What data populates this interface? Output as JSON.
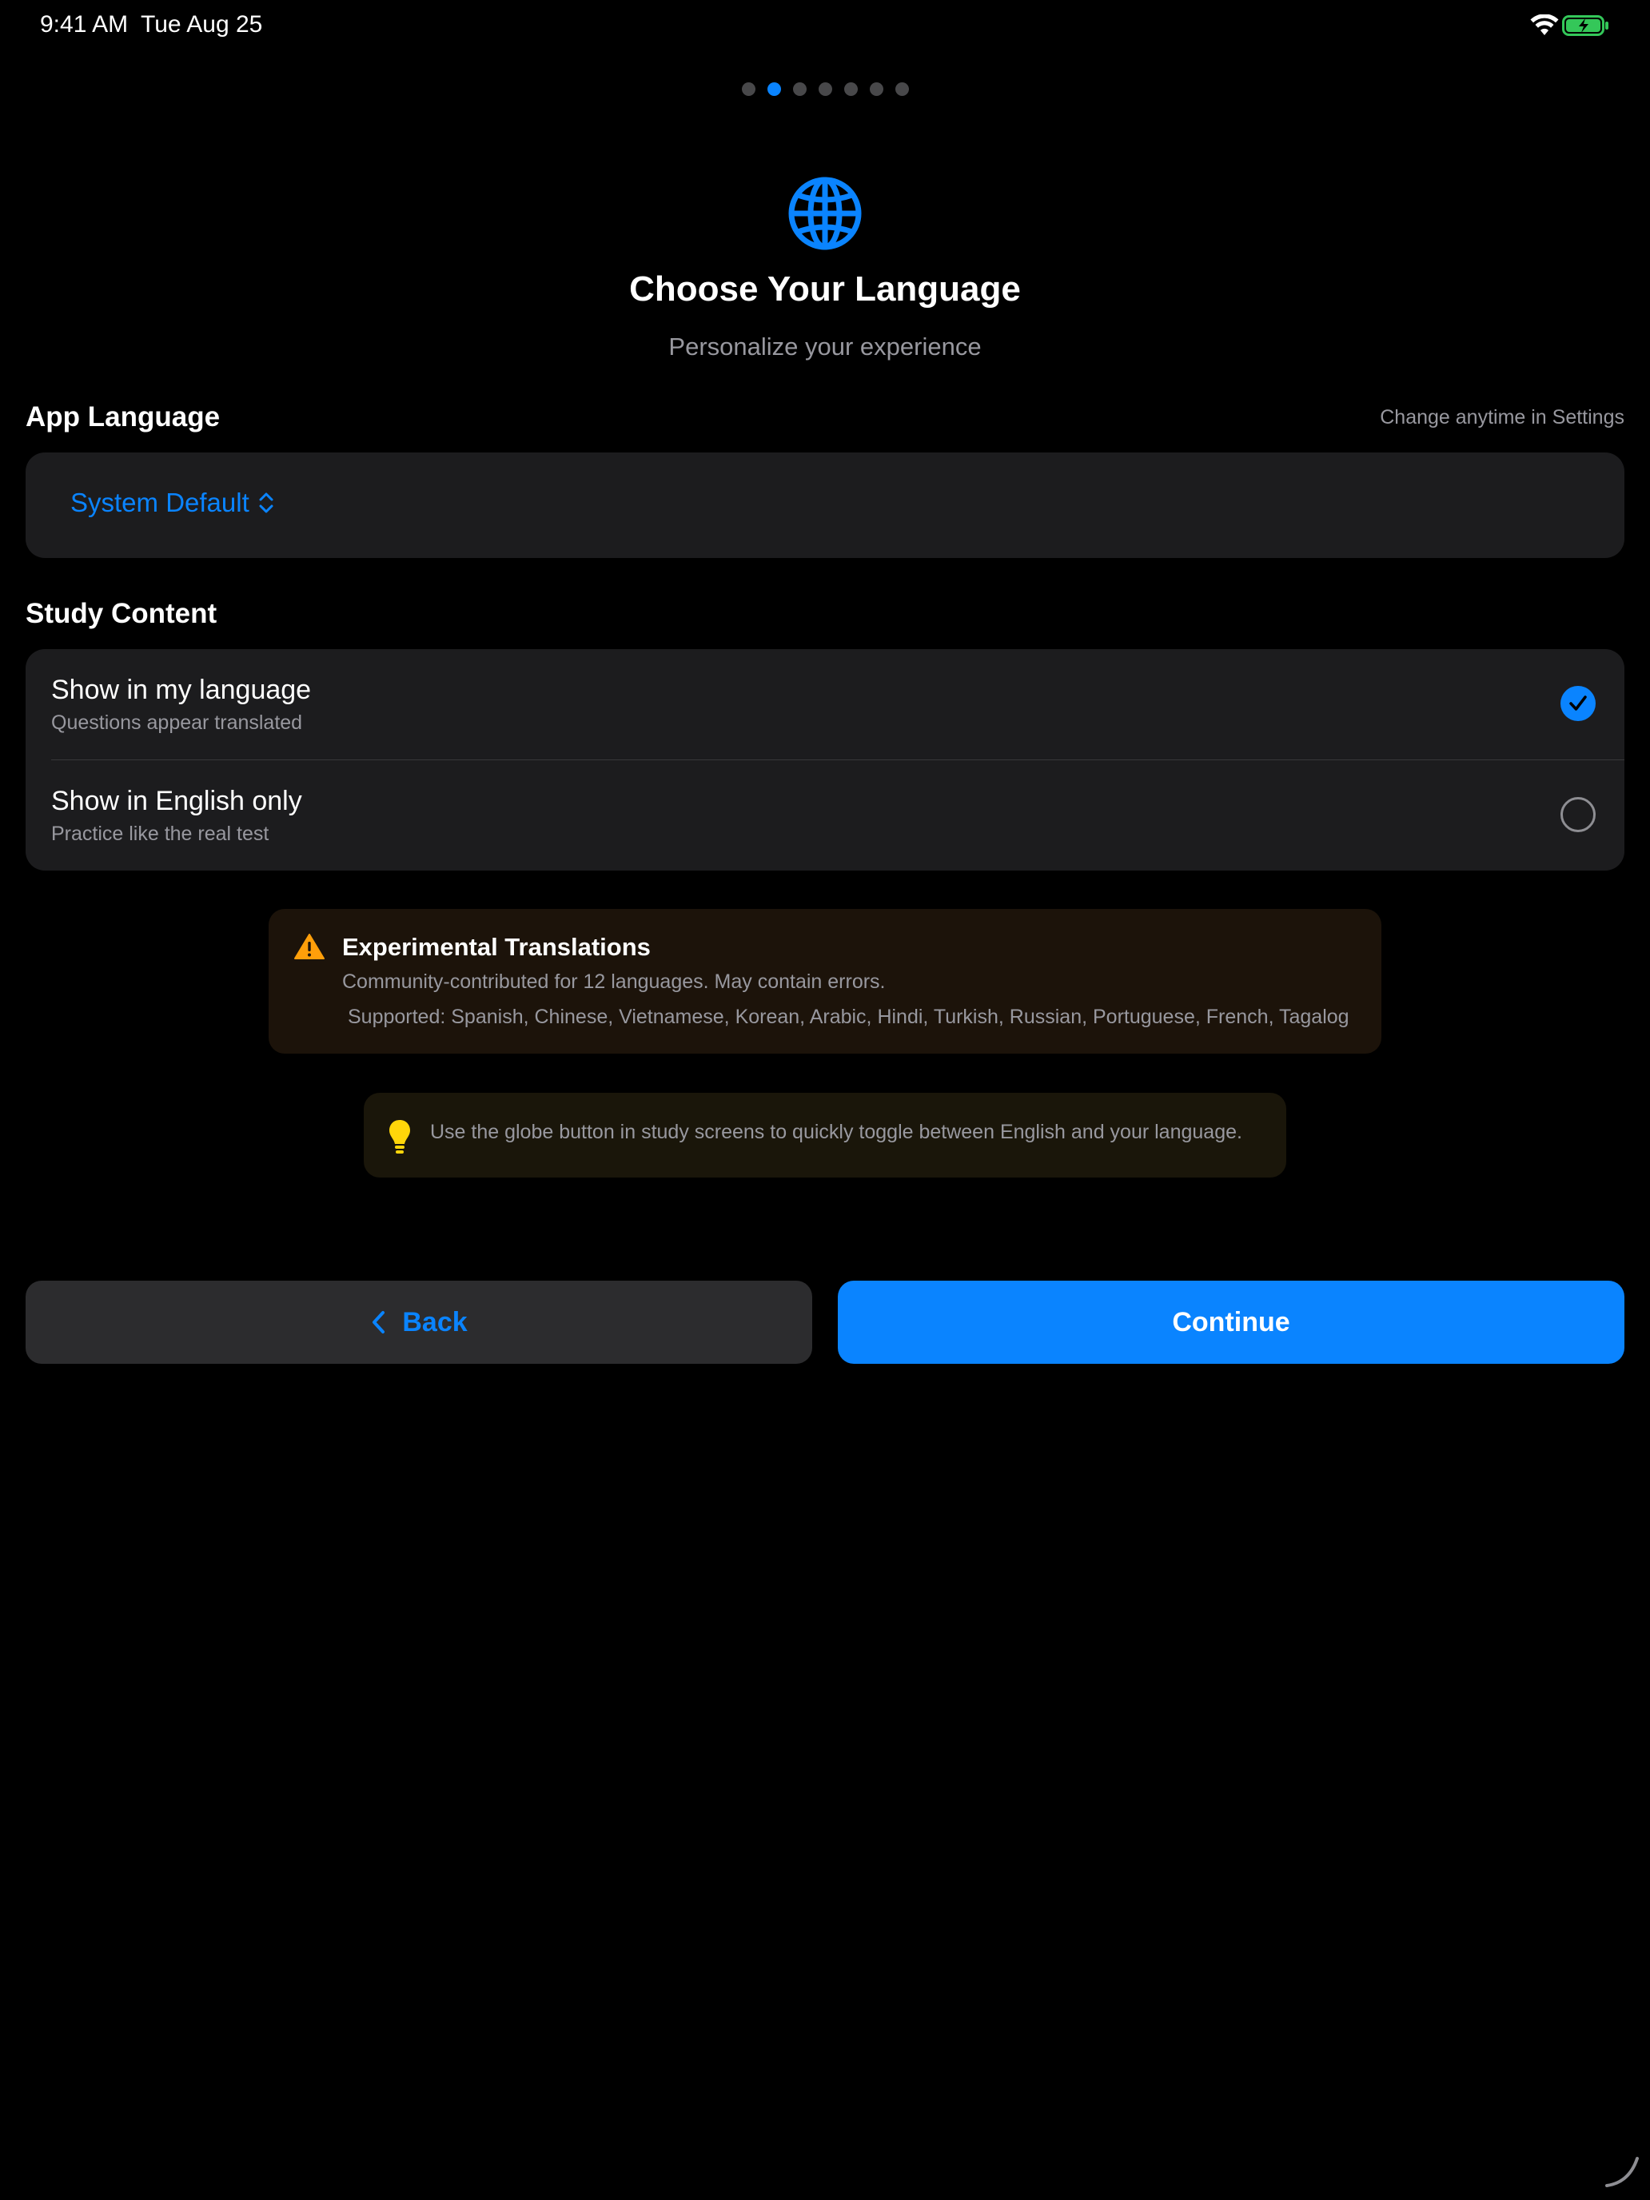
{
  "status_bar": {
    "time": "9:41 AM",
    "date": "Tue Aug 25",
    "icons": [
      "wifi-icon",
      "battery-charging-icon"
    ]
  },
  "pagination": {
    "total": 7,
    "active_index": 1
  },
  "header": {
    "icon": "globe-icon",
    "title": "Choose Your Language",
    "subtitle": "Personalize your experience"
  },
  "app_language": {
    "label": "App Language",
    "hint": "Change anytime in Settings",
    "selected": "System Default"
  },
  "study_content": {
    "label": "Study Content",
    "options": [
      {
        "title": "Show in my language",
        "subtitle": "Questions appear translated",
        "selected": true
      },
      {
        "title": "Show in English only",
        "subtitle": "Practice like the real test",
        "selected": false
      }
    ]
  },
  "warning": {
    "icon": "warning-triangle-icon",
    "title": "Experimental Translations",
    "description": "Community-contributed for 12 languages. May contain errors.",
    "supported": "Supported: Spanish, Chinese, Vietnamese, Korean, Arabic, Hindi, Turkish, Russian, Portuguese, French, Tagalog"
  },
  "tip": {
    "icon": "lightbulb-icon",
    "text": "Use the globe button in study screens to quickly toggle between English and your language."
  },
  "buttons": {
    "back_label": "Back",
    "continue_label": "Continue"
  },
  "colors": {
    "accent": "#0a84ff",
    "background": "#000000",
    "card": "#1c1c1e",
    "warning": "#ff9f0a",
    "tip": "#ffd60a"
  }
}
